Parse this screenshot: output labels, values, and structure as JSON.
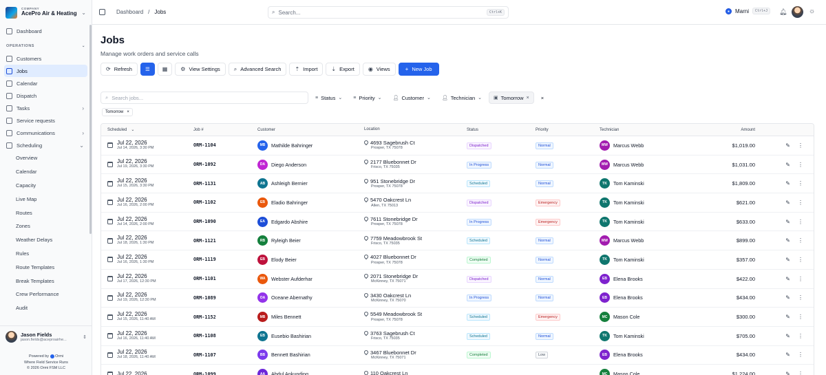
{
  "company": {
    "label": "COMPANY",
    "name": "AcePro Air & Heating"
  },
  "nav": {
    "dashboard": "Dashboard",
    "section_operations": "OPERATIONS",
    "customers": "Customers",
    "jobs": "Jobs",
    "calendar": "Calendar",
    "dispatch": "Dispatch",
    "tasks": "Tasks",
    "service_requests": "Service requests",
    "communications": "Communications",
    "scheduling": "Scheduling",
    "scheduling_items": [
      "Overview",
      "Calendar",
      "Capacity",
      "Live Map",
      "Routes",
      "Zones",
      "Weather Delays",
      "Rules",
      "Route Templates",
      "Break Templates",
      "Crew Performance",
      "Audit"
    ]
  },
  "user": {
    "name": "Jason Fields",
    "email": "jason.fields@aceproairhe..."
  },
  "powered": {
    "prefix": "Powered by",
    "brand": "Ormi",
    "tagline": "Where Field Service Runs",
    "copyright": "© 2026 Ormi FSM LLC"
  },
  "topbar": {
    "crumb_root": "Dashboard",
    "crumb_sep": "/",
    "crumb_current": "Jobs",
    "search_placeholder": "Search...",
    "search_kbd": "Ctrl+K",
    "assistant": "Marni",
    "assistant_kbd": "Ctrl+J"
  },
  "page": {
    "title": "Jobs",
    "subtitle": "Manage work orders and service calls"
  },
  "toolbar": {
    "refresh": "Refresh",
    "view_settings": "View Settings",
    "advanced_search": "Advanced Search",
    "import": "Import",
    "export": "Export",
    "views": "Views",
    "new_job": "New Job"
  },
  "filters": {
    "search_placeholder": "Search jobs...",
    "status": "Status",
    "priority": "Priority",
    "customer": "Customer",
    "technician": "Technician",
    "date": "Tomorrow",
    "chip": "Tomorrow"
  },
  "table": {
    "headers": {
      "scheduled": "Scheduled",
      "job": "Job #",
      "customer": "Customer",
      "location": "Location",
      "status": "Status",
      "priority": "Priority",
      "technician": "Technician",
      "amount": "Amount"
    },
    "rows": [
      {
        "date": "Jul 22, 2026",
        "created": "Jul 14, 2026, 3:30 PM",
        "job": "ORM-1104",
        "cust_init": "MB",
        "cust_color": "#2563eb",
        "customer": "Mathilde Bahringer",
        "addr": "4693 Sagebrush Ct",
        "city": "Prosper, TX 75078",
        "status": "Dispatched",
        "priority": "Normal",
        "tech_init": "MW",
        "tech_color": "#a21caf",
        "tech": "Marcus Webb",
        "amount": "$1,019.00"
      },
      {
        "date": "Jul 22, 2026",
        "created": "Jul 19, 2026, 3:30 PM",
        "job": "ORM-1092",
        "cust_init": "DA",
        "cust_color": "#c026d3",
        "customer": "Diego Anderson",
        "addr": "2177 Bluebonnet Dr",
        "city": "Frisco, TX 75035",
        "status": "In Progress",
        "priority": "Normal",
        "tech_init": "MW",
        "tech_color": "#a21caf",
        "tech": "Marcus Webb",
        "amount": "$1,031.00"
      },
      {
        "date": "Jul 22, 2026",
        "created": "Jul 15, 2026, 3:30 PM",
        "job": "ORM-1131",
        "cust_init": "AB",
        "cust_color": "#0e7490",
        "customer": "Ashleigh Bernier",
        "addr": "951 Stonebridge Dr",
        "city": "Prosper, TX 75078",
        "status": "Scheduled",
        "priority": "Normal",
        "tech_init": "TK",
        "tech_color": "#0f766e",
        "tech": "Tom Kaminski",
        "amount": "$1,809.00"
      },
      {
        "date": "Jul 22, 2026",
        "created": "Jul 16, 2026, 2:00 PM",
        "job": "ORM-1102",
        "cust_init": "EB",
        "cust_color": "#ea580c",
        "customer": "Eladio Bahringer",
        "addr": "5470 Oakcrest Ln",
        "city": "Allen, TX 75013",
        "status": "Dispatched",
        "priority": "Emergency",
        "tech_init": "TK",
        "tech_color": "#0f766e",
        "tech": "Tom Kaminski",
        "amount": "$621.00"
      },
      {
        "date": "Jul 22, 2026",
        "created": "Jul 14, 2026, 2:00 PM",
        "job": "ORM-1090",
        "cust_init": "EA",
        "cust_color": "#1d4ed8",
        "customer": "Edgardo Abshire",
        "addr": "7611 Stonebridge Dr",
        "city": "Prosper, TX 75078",
        "status": "In Progress",
        "priority": "Emergency",
        "tech_init": "TK",
        "tech_color": "#0f766e",
        "tech": "Tom Kaminski",
        "amount": "$633.00"
      },
      {
        "date": "Jul 22, 2026",
        "created": "Jul 18, 2026, 1:30 PM",
        "job": "ORM-1121",
        "cust_init": "RB",
        "cust_color": "#15803d",
        "customer": "Ryleigh Beier",
        "addr": "7759 Meadowbrook St",
        "city": "Frisco, TX 75035",
        "status": "Scheduled",
        "priority": "Normal",
        "tech_init": "MW",
        "tech_color": "#a21caf",
        "tech": "Marcus Webb",
        "amount": "$899.00"
      },
      {
        "date": "Jul 22, 2026",
        "created": "Jul 16, 2026, 1:30 PM",
        "job": "ORM-1119",
        "cust_init": "EB",
        "cust_color": "#be123c",
        "customer": "Elody Beier",
        "addr": "4027 Bluebonnet Dr",
        "city": "Prosper, TX 75078",
        "status": "Completed",
        "priority": "Normal",
        "tech_init": "TK",
        "tech_color": "#0f766e",
        "tech": "Tom Kaminski",
        "amount": "$357.00"
      },
      {
        "date": "Jul 22, 2026",
        "created": "Jul 17, 2026, 12:30 PM",
        "job": "ORM-1101",
        "cust_init": "WA",
        "cust_color": "#ea580c",
        "customer": "Webster Aufderhar",
        "addr": "2071 Stonebridge Dr",
        "city": "McKinney, TX 75071",
        "status": "Dispatched",
        "priority": "Normal",
        "tech_init": "EB",
        "tech_color": "#7e22ce",
        "tech": "Elena Brooks",
        "amount": "$422.00"
      },
      {
        "date": "Jul 22, 2026",
        "created": "Jul 19, 2026, 12:30 PM",
        "job": "ORM-1089",
        "cust_init": "OA",
        "cust_color": "#9333ea",
        "customer": "Oceane Abernathy",
        "addr": "3430 Oakcrest Ln",
        "city": "McKinney, TX 75070",
        "status": "In Progress",
        "priority": "Normal",
        "tech_init": "EB",
        "tech_color": "#7e22ce",
        "tech": "Elena Brooks",
        "amount": "$434.00"
      },
      {
        "date": "Jul 22, 2026",
        "created": "Jul 15, 2026, 11:40 AM",
        "job": "ORM-1152",
        "cust_init": "MB",
        "cust_color": "#b91c1c",
        "customer": "Miles Bennett",
        "addr": "5549 Meadowbrook St",
        "city": "Prosper, TX 75078",
        "status": "Scheduled",
        "priority": "Emergency",
        "tech_init": "MC",
        "tech_color": "#15803d",
        "tech": "Mason Cole",
        "amount": "$300.00"
      },
      {
        "date": "Jul 22, 2026",
        "created": "Jul 16, 2026, 11:40 AM",
        "job": "ORM-1108",
        "cust_init": "EB",
        "cust_color": "#0e7490",
        "customer": "Eusebio Bashirian",
        "addr": "3763 Sagebrush Ct",
        "city": "Frisco, TX 75035",
        "status": "Scheduled",
        "priority": "Normal",
        "tech_init": "TK",
        "tech_color": "#0f766e",
        "tech": "Tom Kaminski",
        "amount": "$705.00"
      },
      {
        "date": "Jul 22, 2026",
        "created": "Jul 18, 2026, 11:40 AM",
        "job": "ORM-1107",
        "cust_init": "BB",
        "cust_color": "#7c3aed",
        "customer": "Bennett Bashirian",
        "addr": "3467 Bluebonnet Dr",
        "city": "McKinney, TX 75071",
        "status": "Completed",
        "priority": "Low",
        "tech_init": "EB",
        "tech_color": "#7e22ce",
        "tech": "Elena Brooks",
        "amount": "$434.00"
      },
      {
        "date": "Jul 22, 2026",
        "created": "",
        "job": "ORM-1099",
        "cust_init": "AA",
        "cust_color": "#6d28d9",
        "customer": "Abdul Ankunding",
        "addr": "110 Oakcrest Ln",
        "city": "",
        "status": "",
        "priority": "",
        "tech_init": "MC",
        "tech_color": "#15803d",
        "tech": "Mason Cole",
        "amount": "$1,224.00"
      }
    ]
  }
}
